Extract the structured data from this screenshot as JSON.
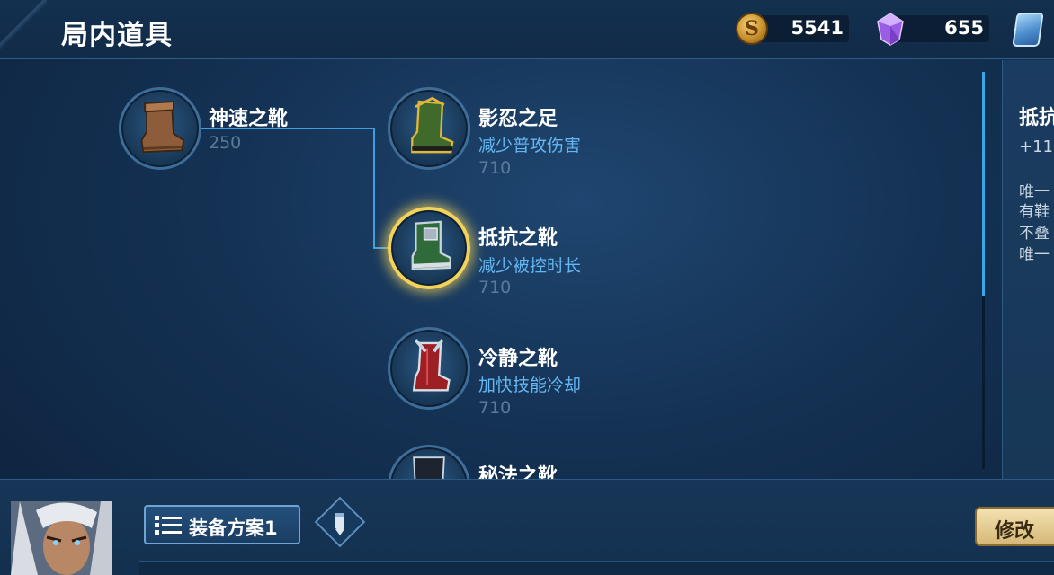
{
  "header": {
    "title": "局内道具",
    "gold": "5541",
    "gems": "655"
  },
  "tree": {
    "base": {
      "name": "神速之靴",
      "price": "250",
      "icon": "boots-icon"
    },
    "items": [
      {
        "name": "影忍之足",
        "desc": "减少普攻伤害",
        "price": "710",
        "icon": "ninja-boots-icon"
      },
      {
        "name": "抵抗之靴",
        "desc": "减少被控时长",
        "price": "710",
        "icon": "resistance-boots-icon",
        "selected": true
      },
      {
        "name": "冷静之靴",
        "desc": "加快技能冷却",
        "price": "710",
        "icon": "calm-boots-icon"
      },
      {
        "name": "秘法之靴",
        "icon": "arcane-boots-icon"
      }
    ]
  },
  "detail": {
    "title": "抵抗",
    "stat": "+11",
    "lines": [
      "唯一",
      "有鞋",
      "不叠",
      "唯一"
    ]
  },
  "bottom": {
    "plan_label": "装备方案1",
    "modify_label": "修改"
  },
  "colors": {
    "accent_blue": "#64b7f2",
    "selected_gold": "#f3d25a",
    "connector": "#3f9ee0"
  }
}
